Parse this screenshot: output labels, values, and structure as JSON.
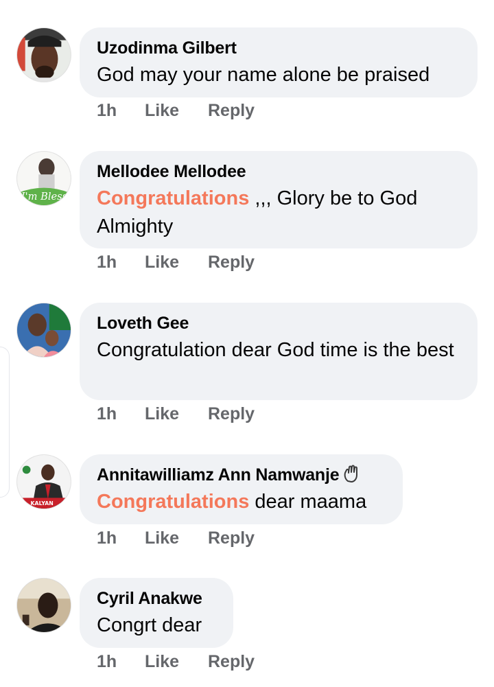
{
  "comments": [
    {
      "author": "Uzodinma Gilbert",
      "text_prefix": "",
      "text": "God may your name alone be praised",
      "time": "1h",
      "like_label": "Like",
      "reply_label": "Reply",
      "avatar_icon": "profile-photo-man-cap"
    },
    {
      "author": "Mellodee Mellodee",
      "text_prefix": "Congratulations",
      "text": " ,,, Glory be to God Almighty",
      "time": "1h",
      "like_label": "Like",
      "reply_label": "Reply",
      "avatar_icon": "profile-photo-blessed",
      "avatar_caption": "I'm Blessed"
    },
    {
      "author": "Loveth Gee",
      "text_prefix": "",
      "text": "Congratulation dear God time is the best",
      "time": "1h",
      "like_label": "Like",
      "reply_label": "Reply",
      "avatar_icon": "profile-photo-mother-child"
    },
    {
      "author": "Annitawilliamz Ann Namwanje",
      "author_badge_icon": "waving-hand-icon",
      "text_prefix": "Congratulations",
      "text": " dear maama",
      "time": "1h",
      "like_label": "Like",
      "reply_label": "Reply",
      "avatar_icon": "profile-photo-campaign-poster",
      "avatar_caption": "KALYAN"
    },
    {
      "author": "Cyril Anakwe",
      "text_prefix": "",
      "text": "Congrt dear",
      "time": "1h",
      "like_label": "Like",
      "reply_label": "Reply",
      "avatar_icon": "profile-photo-man-indoor"
    }
  ],
  "colors": {
    "bubble_bg": "#f0f2f5",
    "mention_tag": "#f4785a",
    "action_text": "#65676b"
  }
}
